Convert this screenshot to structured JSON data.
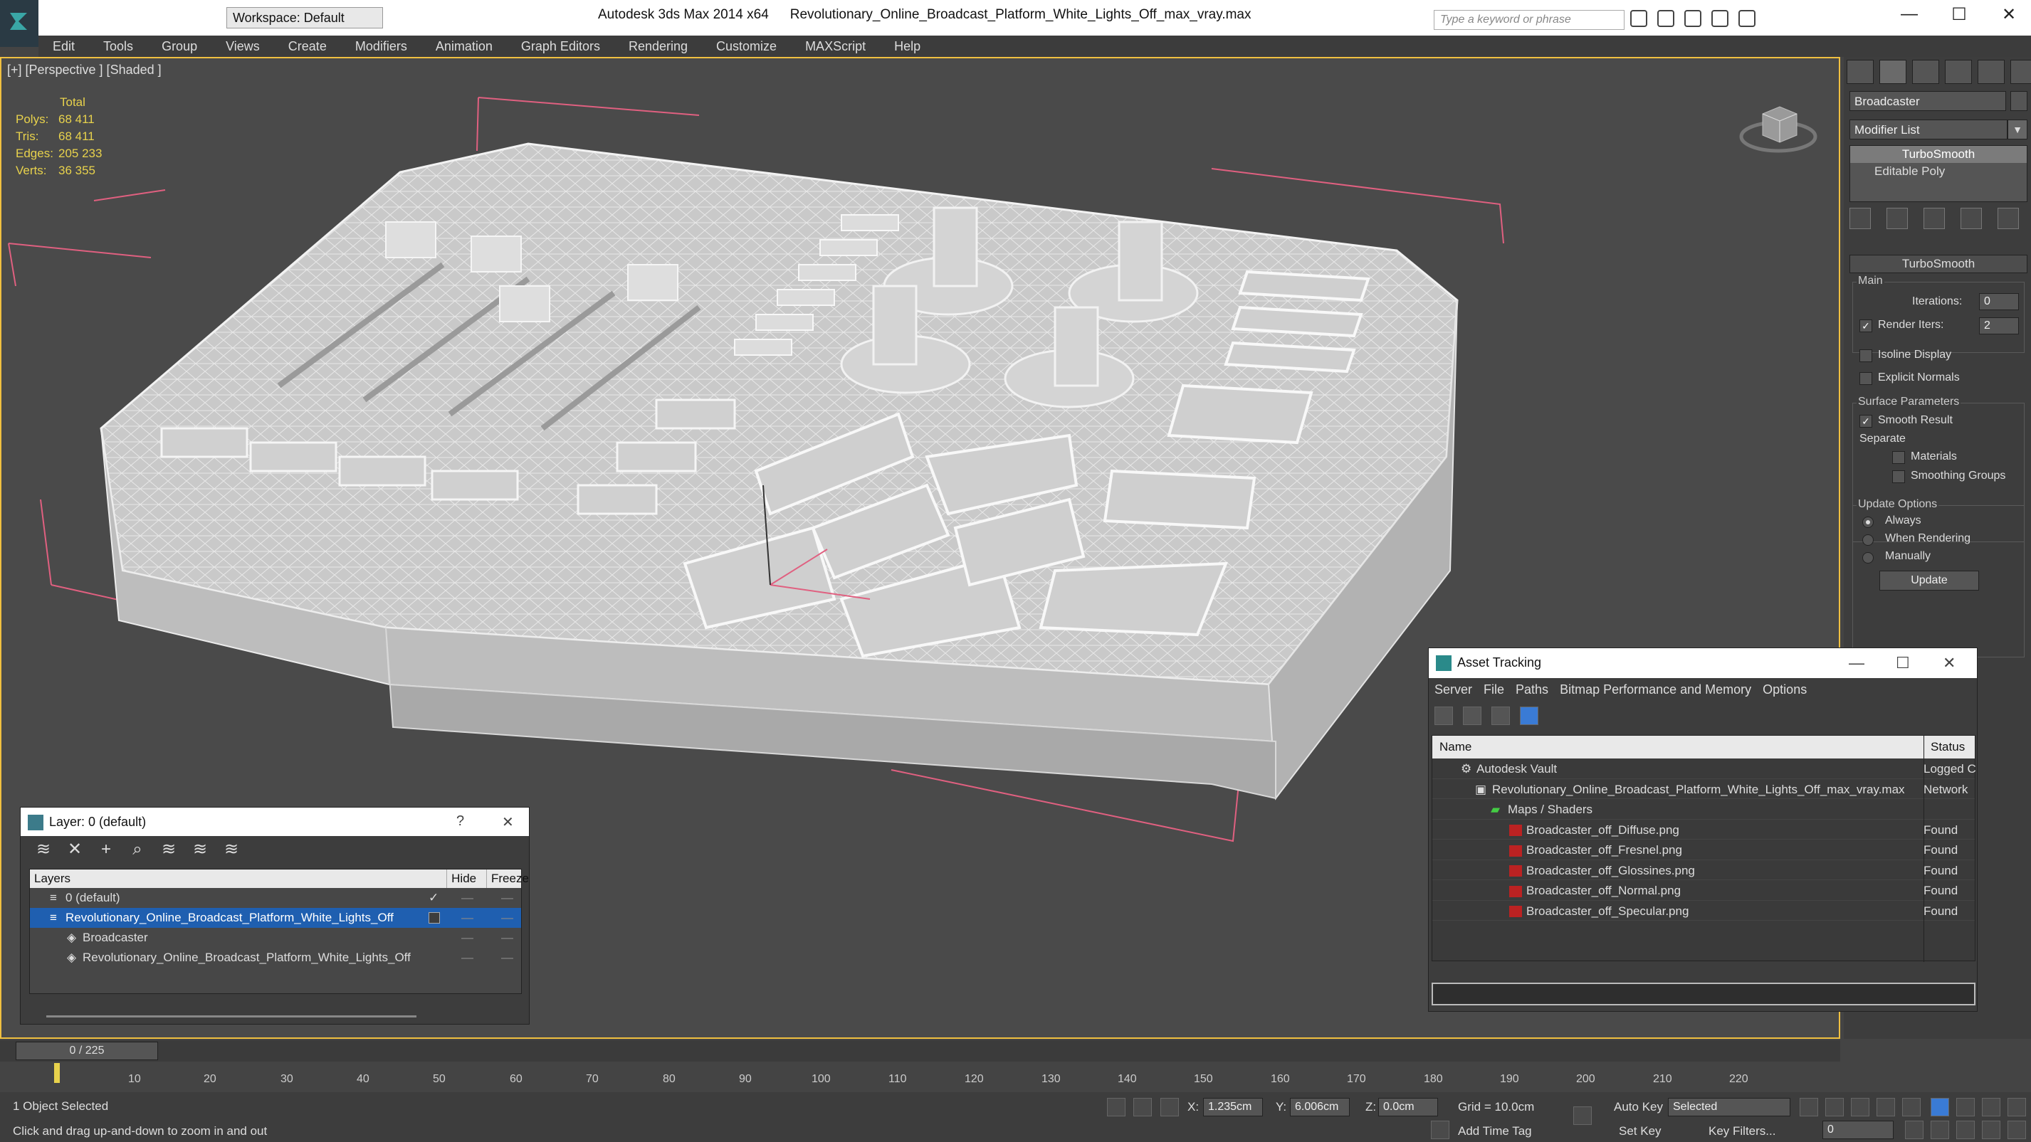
{
  "titlebar": {
    "workspace": "Workspace: Default",
    "app": "Autodesk 3ds Max  2014 x64",
    "file": "Revolutionary_Online_Broadcast_Platform_White_Lights_Off_max_vray.max",
    "search_placeholder": "Type a keyword or phrase",
    "minimize": "—",
    "maximize": "☐",
    "close": "✕"
  },
  "menu": [
    "Edit",
    "Tools",
    "Group",
    "Views",
    "Create",
    "Modifiers",
    "Animation",
    "Graph Editors",
    "Rendering",
    "Customize",
    "MAXScript",
    "Help"
  ],
  "viewport": {
    "label": "[+] [Perspective ] [Shaded ]",
    "stats": {
      "total": "Total",
      "polys_label": "Polys:",
      "polys": "68 411",
      "tris_label": "Tris:",
      "tris": "68 411",
      "edges_label": "Edges:",
      "edges": "205 233",
      "verts_label": "Verts:",
      "verts": "36 355"
    }
  },
  "command_panel": {
    "object_name": "Broadcaster",
    "modifier_list": "Modifier List",
    "stack": [
      "TurboSmooth",
      "Editable Poly"
    ],
    "rollout": "TurboSmooth",
    "main_group": "Main",
    "iterations_label": "Iterations:",
    "iterations": "0",
    "render_iters_label": "Render Iters:",
    "render_iters": "2",
    "isoline": "Isoline Display",
    "explicit_normals": "Explicit Normals",
    "surface_group": "Surface Parameters",
    "smooth_result": "Smooth Result",
    "separate": "Separate",
    "materials": "Materials",
    "smoothing_groups": "Smoothing Groups",
    "update_group": "Update Options",
    "always": "Always",
    "when_rendering": "When Rendering",
    "manually": "Manually",
    "update_button": "Update"
  },
  "layer_panel": {
    "title": "Layer: 0 (default)",
    "help": "?",
    "close": "✕",
    "col_layers": "Layers",
    "col_hide": "Hide",
    "col_freeze": "Freeze",
    "rows": [
      {
        "name": "0 (default)"
      },
      {
        "name": "Revolutionary_Online_Broadcast_Platform_White_Lights_Off"
      },
      {
        "name": "Broadcaster"
      },
      {
        "name": "Revolutionary_Online_Broadcast_Platform_White_Lights_Off"
      }
    ]
  },
  "asset_tracking": {
    "title": "Asset Tracking",
    "menu": [
      "Server",
      "File",
      "Paths",
      "Bitmap Performance and Memory",
      "Options"
    ],
    "col_name": "Name",
    "col_status": "Status",
    "rows": [
      {
        "name": "Autodesk Vault",
        "status": "Logged C"
      },
      {
        "name": "Revolutionary_Online_Broadcast_Platform_White_Lights_Off_max_vray.max",
        "status": "Network"
      },
      {
        "name": "Maps / Shaders",
        "status": ""
      },
      {
        "name": "Broadcaster_off_Diffuse.png",
        "status": "Found"
      },
      {
        "name": "Broadcaster_off_Fresnel.png",
        "status": "Found"
      },
      {
        "name": "Broadcaster_off_Glossines.png",
        "status": "Found"
      },
      {
        "name": "Broadcaster_off_Normal.png",
        "status": "Found"
      },
      {
        "name": "Broadcaster_off_Specular.png",
        "status": "Found"
      }
    ]
  },
  "timeline": {
    "frame": "0 / 225",
    "ticks": [
      "10",
      "20",
      "30",
      "40",
      "50",
      "60",
      "70",
      "80",
      "90",
      "100",
      "110",
      "120",
      "130",
      "140",
      "150",
      "160",
      "170",
      "180",
      "190",
      "200",
      "210",
      "220"
    ]
  },
  "status": {
    "selected": "1 Object Selected",
    "prompt": "Click and drag up-and-down to zoom in and out",
    "x_label": "X:",
    "x": "1.235cm",
    "y_label": "Y:",
    "y": "6.006cm",
    "z_label": "Z:",
    "z": "0.0cm",
    "grid": "Grid = 10.0cm",
    "auto_key": "Auto Key",
    "selected_combo": "Selected",
    "set_key": "Set Key",
    "key_filters": "Key Filters...",
    "add_time_tag": "Add Time Tag",
    "frame_field": "0"
  }
}
